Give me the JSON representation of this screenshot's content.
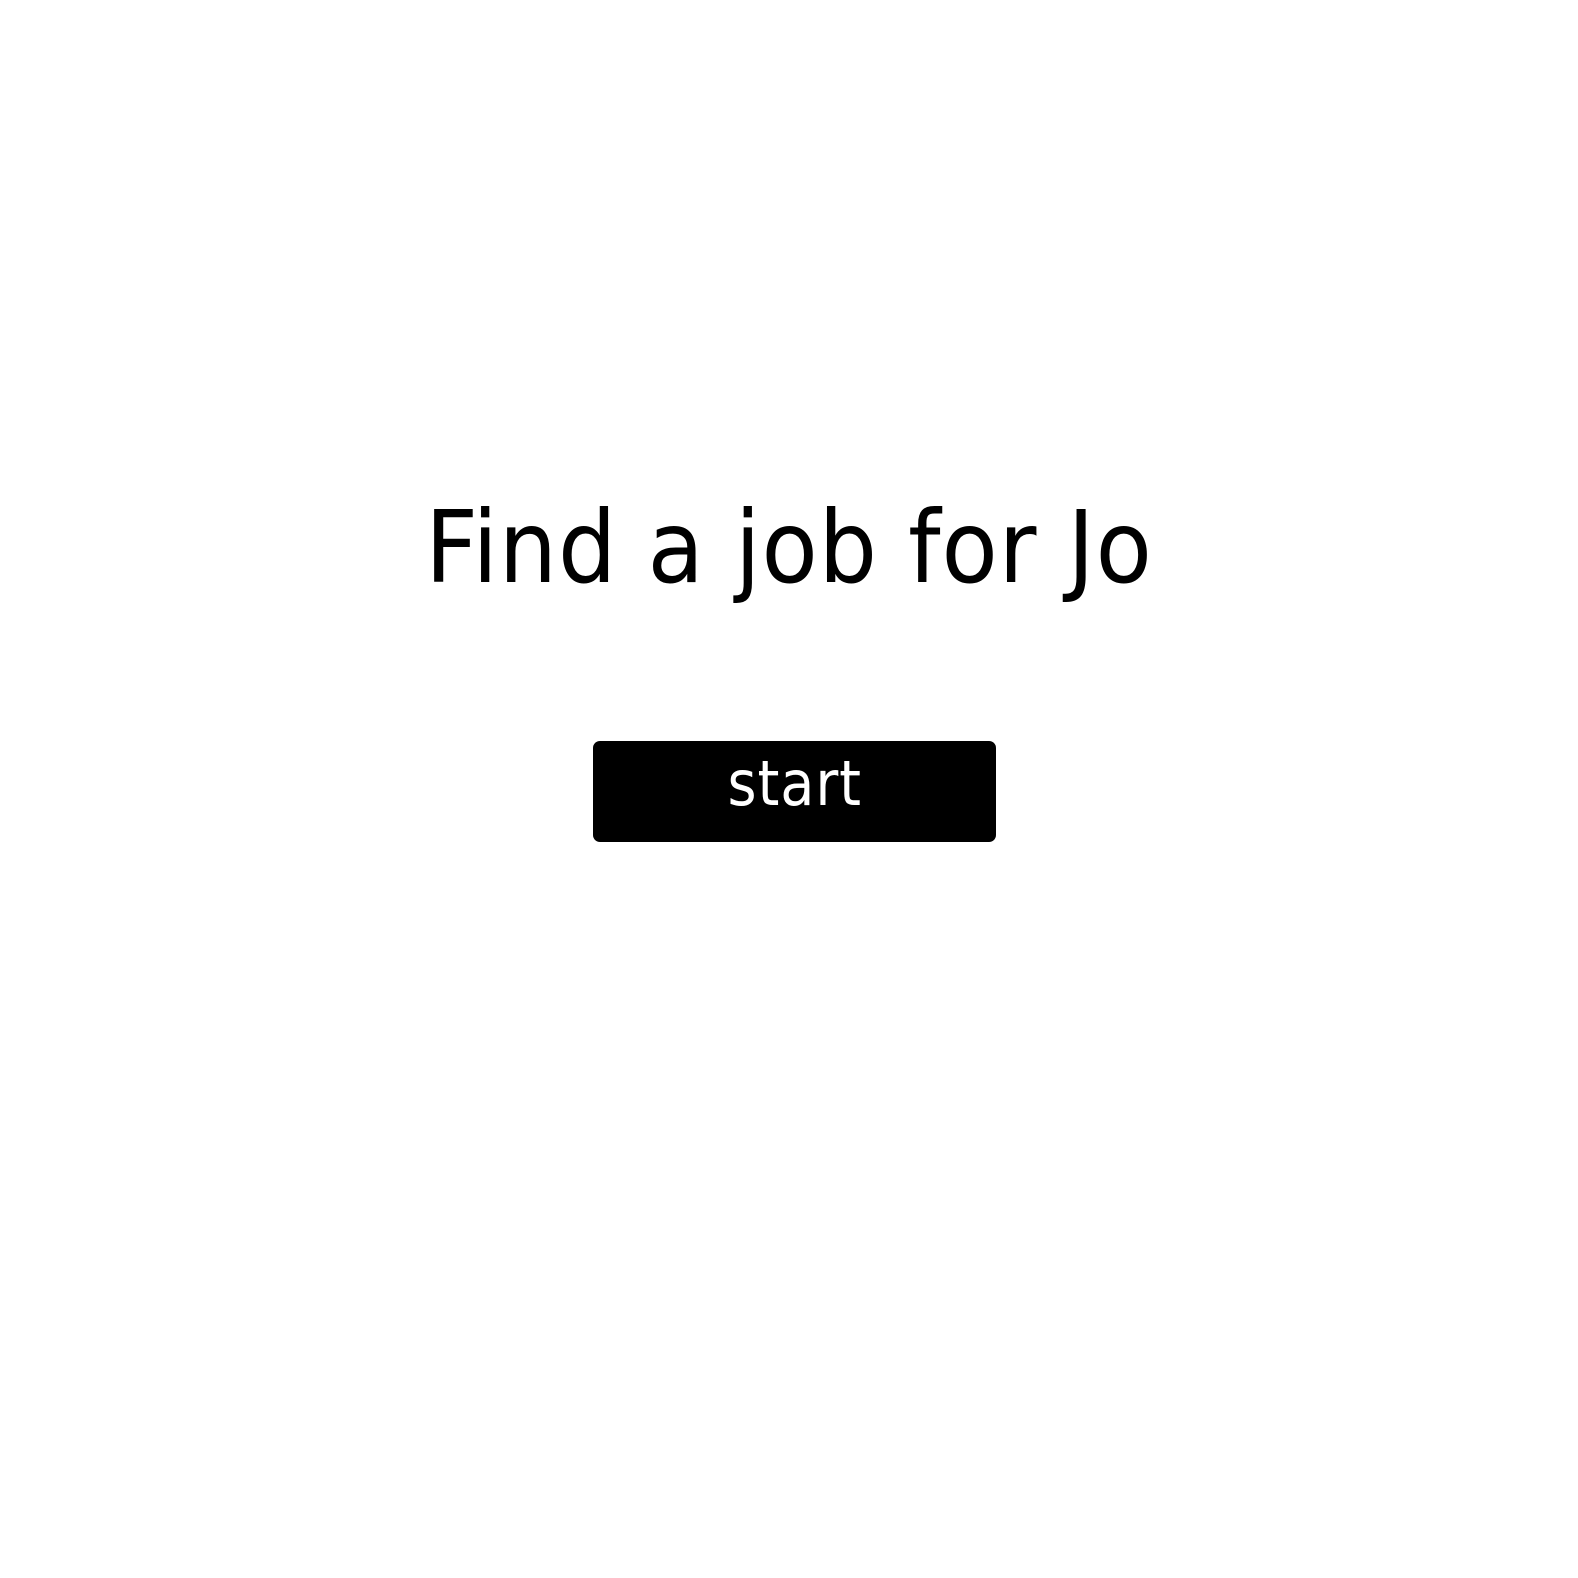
{
  "title": "Find a job for Jo",
  "start_button": {
    "label": "start"
  },
  "colors": {
    "background": "#ffffff",
    "text": "#000000",
    "button_background": "#000000",
    "button_text": "#ffffff"
  }
}
